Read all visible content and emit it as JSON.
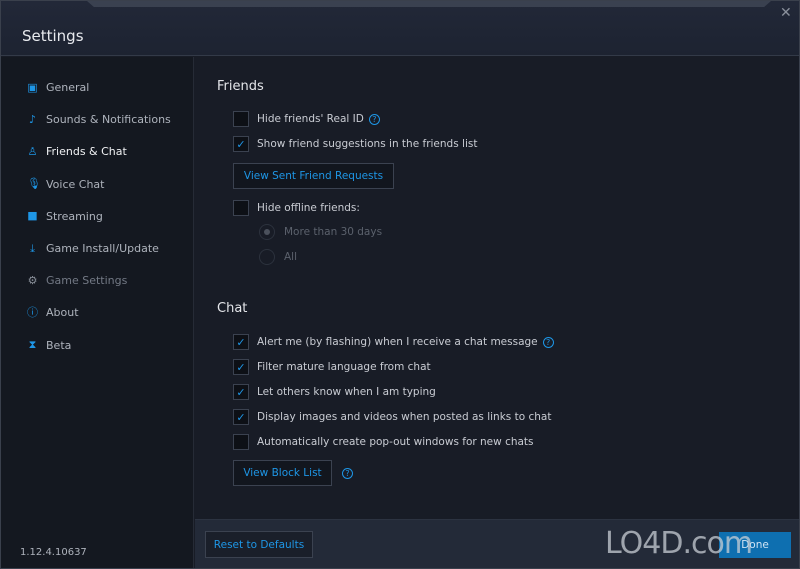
{
  "window": {
    "title": "Settings",
    "close_icon": "close-icon"
  },
  "sidebar": {
    "items": [
      {
        "label": "General",
        "icon": "monitor-gear-icon",
        "glyph": "▣",
        "state": "normal"
      },
      {
        "label": "Sounds & Notifications",
        "icon": "sound-icon",
        "glyph": "♪",
        "state": "normal"
      },
      {
        "label": "Friends & Chat",
        "icon": "person-icon",
        "glyph": "♙",
        "state": "active"
      },
      {
        "label": "Voice Chat",
        "icon": "microphone-icon",
        "glyph": "🎙",
        "state": "normal"
      },
      {
        "label": "Streaming",
        "icon": "video-camera-icon",
        "glyph": "■",
        "state": "normal"
      },
      {
        "label": "Game Install/Update",
        "icon": "download-icon",
        "glyph": "⤓",
        "state": "normal"
      },
      {
        "label": "Game Settings",
        "icon": "game-settings-icon",
        "glyph": "⚙",
        "state": "disabled"
      },
      {
        "label": "About",
        "icon": "info-icon",
        "glyph": "ⓘ",
        "state": "normal"
      },
      {
        "label": "Beta",
        "icon": "beta-flask-icon",
        "glyph": "⧗",
        "state": "normal"
      }
    ],
    "version": "1.12.4.10637"
  },
  "friends": {
    "heading": "Friends",
    "hide_real_id": {
      "label": "Hide friends' Real ID",
      "checked": false
    },
    "show_suggestions": {
      "label": "Show friend suggestions in the friends list",
      "checked": true
    },
    "view_sent_button": "View Sent Friend Requests",
    "hide_offline": {
      "label": "Hide offline friends:",
      "checked": false
    },
    "offline_options": [
      {
        "label": "More than 30 days",
        "selected": true
      },
      {
        "label": "All",
        "selected": false
      }
    ]
  },
  "chat": {
    "heading": "Chat",
    "options": [
      {
        "label": "Alert me (by flashing) when I receive a chat message",
        "checked": true,
        "help": true
      },
      {
        "label": "Filter mature language from chat",
        "checked": true
      },
      {
        "label": "Let others know when I am typing",
        "checked": true
      },
      {
        "label": "Display images and videos when posted as links to chat",
        "checked": true
      },
      {
        "label": "Automatically create pop-out windows for new chats",
        "checked": false
      }
    ],
    "view_block_button": "View Block List"
  },
  "footer": {
    "reset_button": "Reset to Defaults",
    "done_button": "Done"
  },
  "watermark": "LO4D.com",
  "colors": {
    "accent": "#1e96e6",
    "done": "#0e6fb0"
  }
}
